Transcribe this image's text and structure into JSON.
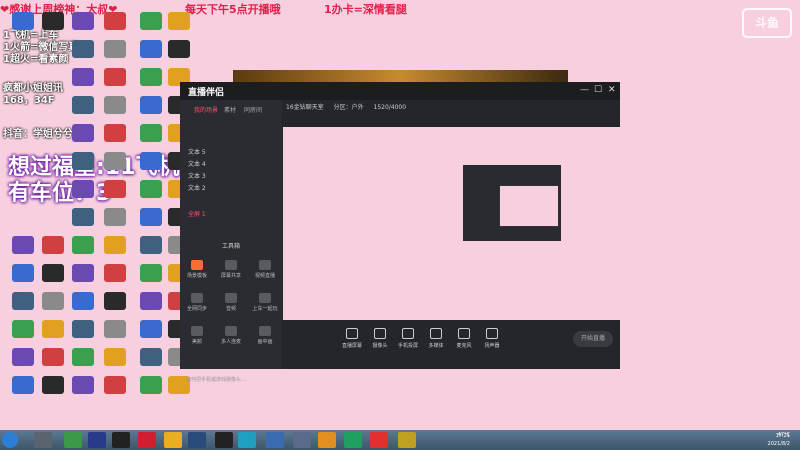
{
  "overlay": {
    "banner_thanks": "❤感谢上周榜神：大叔❤",
    "banner_schedule": "每天下午5点开播哦",
    "banner_card": "1办卡=深情看腿",
    "rules": [
      "1飞机=上车",
      "1火箭=微信写真",
      "1超火=看素颜"
    ],
    "info_title": "疯都小姐姐讯",
    "info_size": "168，34F",
    "tiktok": "抖音：学姐兮兮",
    "wish_line1": "想过福星:11飞机 ❤",
    "wish_line2": "有车位：3",
    "logo_text": "斗鱼"
  },
  "app": {
    "title": "直播伴侣",
    "tabs": [
      "我的场景",
      "素材",
      "同房间"
    ],
    "scenes": [
      "文本 5",
      "文本 4",
      "文本 3",
      "文本 2",
      "全屏 1"
    ],
    "toolbox_title": "工具箱",
    "tools": [
      "场景模板",
      "屏幕共享",
      "视频直播",
      "全网同步",
      "音频",
      "上车一起玩",
      "美颜",
      "多人连麦",
      "画中画"
    ],
    "footer_hint": "如何把手机或游戏摄像头...",
    "header_info": [
      "16金钻聊天室",
      "分区：户外",
      "1520/4000"
    ],
    "bottom_items": [
      "直播屏幕",
      "摄像头",
      "手机投屏",
      "多媒体",
      "麦克风",
      "扬声器"
    ],
    "start_live_label": "开始直播"
  },
  "taskbar": {
    "clock_time": "17:21",
    "clock_date": "2021/8/2",
    "tray_text": "47°C"
  },
  "colors": {
    "desktop_bg": "#f8cfdf",
    "accent": "#ff4f6d"
  }
}
